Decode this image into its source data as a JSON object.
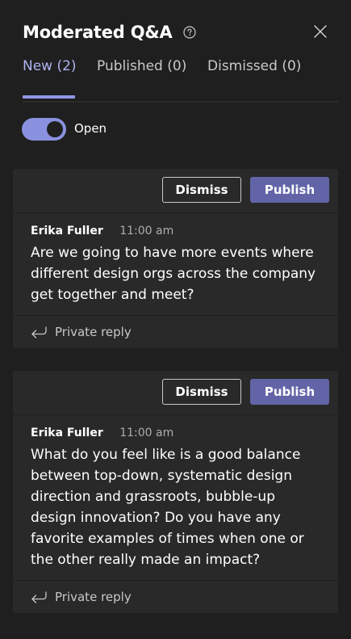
{
  "header": {
    "title": "Moderated Q&A"
  },
  "tabs": [
    {
      "label": "New (2)"
    },
    {
      "label": "Published (0)"
    },
    {
      "label": "Dismissed (0)"
    }
  ],
  "toggle": {
    "label": "Open",
    "state": "on"
  },
  "cards": [
    {
      "dismiss_label": "Dismiss",
      "publish_label": "Publish",
      "author": "Erika Fuller",
      "time": "11:00 am",
      "question": "Are we going to have more events where different design orgs across the company get together and meet?",
      "reply_label": "Private reply"
    },
    {
      "dismiss_label": "Dismiss",
      "publish_label": "Publish",
      "author": "Erika Fuller",
      "time": "11:00 am",
      "question": "What do you feel like is a good balance between top-down, systematic design direction and grassroots, bubble-up design innovation? Do you have any favorite examples of times when one or the other really made an impact?",
      "reply_label": "Private reply"
    }
  ],
  "colors": {
    "accent": "#6264a7",
    "tab_active": "#aeb4f0",
    "background": "#1f1f1f",
    "card": "#292929"
  },
  "icons": {
    "help": "help-circle-icon",
    "close": "close-icon",
    "reply": "reply-arrow-icon"
  }
}
